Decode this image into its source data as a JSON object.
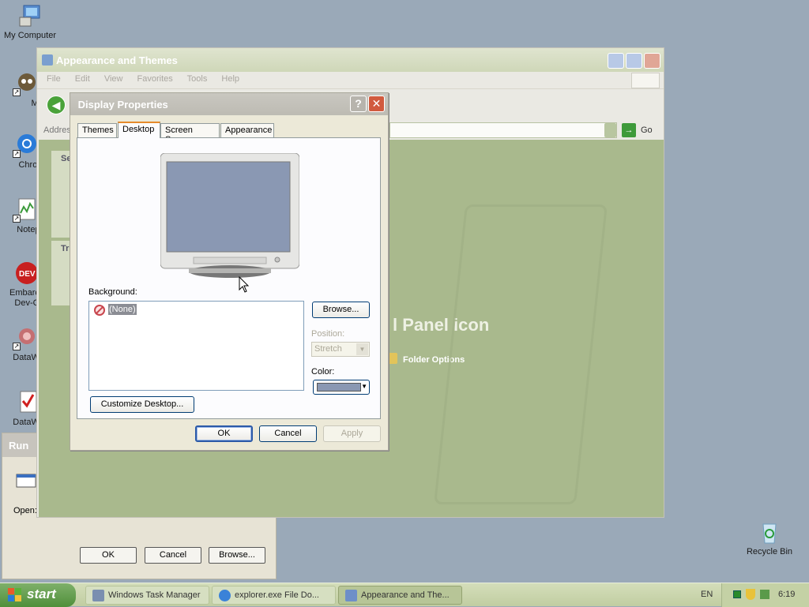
{
  "desktop": {
    "icons": [
      {
        "label": "My Computer"
      },
      {
        "label": "MyPal"
      },
      {
        "label": "Chrom"
      },
      {
        "label": "Notepa"
      },
      {
        "label": "Embarca Dev-C"
      },
      {
        "label": "DataWag"
      },
      {
        "label": "DataWag"
      },
      {
        "label": "Recycle Bin"
      }
    ]
  },
  "run_dialog": {
    "title": "Run",
    "open_label": "Open:",
    "ok": "OK",
    "cancel": "Cancel",
    "browse": "Browse..."
  },
  "appearance_window": {
    "title": "Appearance and Themes",
    "menu": [
      "File",
      "Edit",
      "View",
      "Favorites",
      "Tools",
      "Help"
    ],
    "address_label": "Addres",
    "go": "Go",
    "left_pane_headers": [
      "Se",
      "Tr"
    ],
    "panel_heading": "l Panel icon",
    "folder_options": "Folder Options",
    "partial_title_letter": "l"
  },
  "display_properties": {
    "title": "Display Properties",
    "help": "?",
    "tabs": [
      "Themes",
      "Desktop",
      "Screen Saver",
      "Appearance"
    ],
    "active_tab": "Desktop",
    "background_label": "Background:",
    "background_items": [
      "(None)"
    ],
    "browse": "Browse...",
    "position_label": "Position:",
    "position_value": "Stretch",
    "color_label": "Color:",
    "color_value": "#8a98b3",
    "customize": "Customize Desktop...",
    "ok": "OK",
    "cancel": "Cancel",
    "apply": "Apply"
  },
  "taskbar": {
    "start": "start",
    "tasks": [
      {
        "label": "Windows Task Manager",
        "icon": "task-manager-icon"
      },
      {
        "label": "explorer.exe File Do...",
        "icon": "chrome-icon"
      },
      {
        "label": "Appearance and The...",
        "icon": "control-panel-icon",
        "active": true
      }
    ],
    "language": "EN",
    "clock": "6:19"
  }
}
